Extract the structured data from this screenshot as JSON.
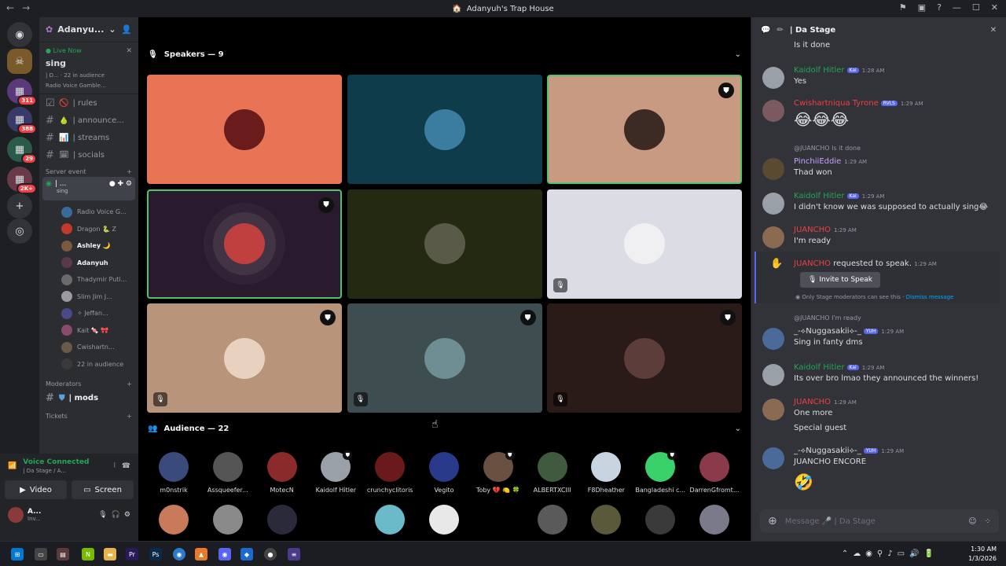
{
  "window": {
    "title": "Adanyuh's Trap House"
  },
  "servers": {
    "badges": [
      "311",
      "388",
      "29",
      "2K+"
    ]
  },
  "sidebar": {
    "server_name": "Adanyuh's Trap House",
    "server_name_short": "Adanyu...",
    "live_label": "Live Now",
    "live_title": "sing",
    "live_meta": "| D... · 22 in audience",
    "live_sub": "Radio Voice Gamble...",
    "channels": [
      {
        "label": "| rules",
        "icon": "🚫"
      },
      {
        "label": "| announce...",
        "icon": "🍐"
      },
      {
        "label": "| streams",
        "icon": "📊"
      },
      {
        "label": "| socials",
        "icon": "🗓"
      }
    ],
    "server_event_label": "Server event",
    "stage_channel_label": "| ...",
    "stage_channel_sub": "sing",
    "voice_users": [
      "Radio Voice G...",
      "Dragon 🐍 Z",
      "Ashley 🌙",
      "Adanyuh",
      "Thadymir Puti...",
      "Slim Jim J...",
      "✧ Jeffan...",
      "Kait 🍬 🎀",
      "Cwishartn...",
      "22 in audience"
    ],
    "moderators_label": "Moderators",
    "mods_channel": "| mods",
    "tickets_label": "Tickets"
  },
  "user_panel": {
    "voice_status": "Voice Connected",
    "voice_sub": "| Da Stage / A...",
    "video_label": "Video",
    "screen_label": "Screen",
    "username": "A...",
    "user_status": "Inv..."
  },
  "stage": {
    "speakers_header": "Speakers — 9",
    "audience_header": "Audience — 22",
    "speakers": [
      {
        "bg": "#e87455",
        "ring": "#6a1c1c",
        "mod": false,
        "mute": false,
        "highlight": false
      },
      {
        "bg": "#0e3c4a",
        "ring": "#3a7da0",
        "mod": false,
        "mute": false,
        "highlight": false
      },
      {
        "bg": "#c99a82",
        "ring": "#3b2b24",
        "mod": true,
        "mute": false,
        "highlight": true
      },
      {
        "bg": "#2a1a2e",
        "ring": "#c04040",
        "mod": true,
        "mute": false,
        "highlight": true
      },
      {
        "bg": "#242a12",
        "ring": "#5a5a48",
        "mod": false,
        "mute": false,
        "highlight": false
      },
      {
        "bg": "#dcdde4",
        "ring": "#f0f0f3",
        "mod": false,
        "mute": true,
        "highlight": false
      },
      {
        "bg": "#b8957a",
        "ring": "#e8d2bf",
        "mod": true,
        "mute": true,
        "highlight": false
      },
      {
        "bg": "#3e4d50",
        "ring": "#6e8e94",
        "mod": true,
        "mute": true,
        "highlight": false
      },
      {
        "bg": "#2a1a18",
        "ring": "#5c3d3a",
        "mod": true,
        "mute": true,
        "highlight": false
      }
    ],
    "audience": [
      {
        "name": "m0nstrik",
        "color": "#3a4a7a",
        "mod": false
      },
      {
        "name": "Assqueefer...",
        "color": "#555",
        "mod": false
      },
      {
        "name": "MotecN",
        "color": "#8a2a2a",
        "mod": false
      },
      {
        "name": "Kaidolf Hitler",
        "color": "#9aa0a8",
        "mod": true
      },
      {
        "name": "crunchyclitoris",
        "color": "#6a1a1a",
        "mod": false
      },
      {
        "name": "Vegito",
        "color": "#2a3a8a",
        "mod": false
      },
      {
        "name": "Toby 💔 🍋 🍀",
        "color": "#6a5040",
        "mod": true
      },
      {
        "name": "ALBERTXCIII",
        "color": "#405a40",
        "mod": false
      },
      {
        "name": "F8Dheather",
        "color": "#c8d4e0",
        "mod": false
      },
      {
        "name": "Bangladeshi c...",
        "color": "#3ad06a",
        "mod": true
      },
      {
        "name": "DarrenGfromt...",
        "color": "#8a3a4a",
        "mod": false
      }
    ],
    "audience_row2_colors": [
      "#c87a5a",
      "#8a8a8a",
      "#2a2a3a",
      "#6abaca",
      "#e8e8e8",
      "#5a5a5a",
      "#5a5a3a",
      "#3a3a3a",
      "#7a7a8a"
    ]
  },
  "chat": {
    "channel_name": "| Da Stage",
    "top_text": "Is it done",
    "messages": [
      {
        "user": "Kaidolf Hitler",
        "color": "#23a55a",
        "tag": "Kai",
        "time": "1:28 AM",
        "lines": [
          "Yes"
        ],
        "av": "#9aa0a8"
      },
      {
        "user": "Cwishartniqua Tyrone",
        "color": "#f23f43",
        "tag": "RVLS",
        "time": "1:29 AM",
        "lines": [
          "😂😂😂"
        ],
        "av": "#7a5a60"
      },
      {
        "user": "PinchiiEddie",
        "color": "#c9a0ff",
        "tag": "",
        "time": "1:29 AM",
        "lines": [
          "Thad won"
        ],
        "av": "#5a4a30",
        "reply": "@JUANCHO Is it done"
      },
      {
        "user": "Kaidolf Hitler",
        "color": "#23a55a",
        "tag": "Kai",
        "time": "1:29 AM",
        "lines": [
          "I didn't know we was supposed to actually sing😂"
        ],
        "av": "#9aa0a8"
      },
      {
        "user": "JUANCHO",
        "color": "#f23f43",
        "tag": "",
        "time": "1:29 AM",
        "lines": [
          "I'm ready"
        ],
        "av": "#8a6a50"
      },
      {
        "user": "_-⟡Nuggasakii⟡-_",
        "color": "#dbdee1",
        "tag": "YUH",
        "time": "1:29 AM",
        "lines": [
          "Sing in fanty dms"
        ],
        "av": "#4a6a9a",
        "reply": "@JUANCHO I'm ready"
      },
      {
        "user": "Kaidolf Hitler",
        "color": "#23a55a",
        "tag": "Kai",
        "time": "1:29 AM",
        "lines": [
          "Its over bro lmao they announced the winners!"
        ],
        "av": "#9aa0a8"
      },
      {
        "user": "JUANCHO",
        "color": "#f23f43",
        "tag": "",
        "time": "1:29 AM",
        "lines": [
          "One more",
          "Special guest"
        ],
        "av": "#8a6a50"
      },
      {
        "user": "_-⟡Nuggasakii⟡-_",
        "color": "#dbdee1",
        "tag": "YUH",
        "time": "1:29 AM",
        "lines": [
          "JUANCHO ENCORE",
          "🤣"
        ],
        "av": "#4a6a9a"
      }
    ],
    "speak_request": {
      "user": "JUANCHO",
      "text": "requested to speak.",
      "time": "1:29 AM",
      "button": "Invite to Speak",
      "note": "Only Stage moderators can see this ·",
      "dismiss": "Dismiss message"
    },
    "placeholder": "Message 🎤 | Da Stage"
  },
  "taskbar": {
    "time": "1:30 AM",
    "date": "1/3/2026"
  }
}
